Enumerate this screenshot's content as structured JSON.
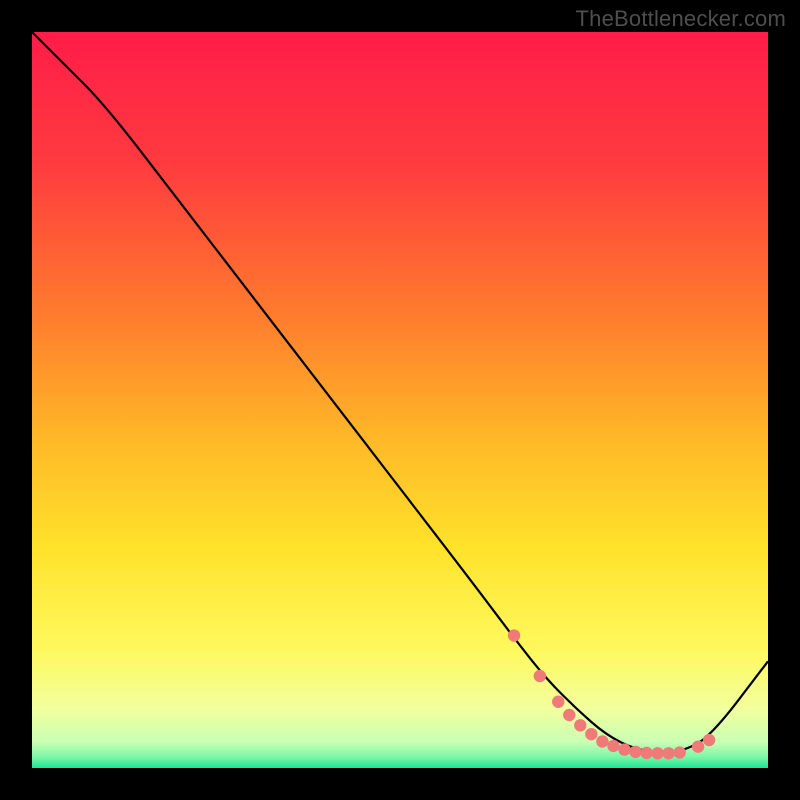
{
  "watermark": "TheBottlenecker.com",
  "chart_data": {
    "type": "line",
    "title": "",
    "xlabel": "",
    "ylabel": "",
    "xlim": [
      0,
      100
    ],
    "ylim": [
      0,
      100
    ],
    "grid": false,
    "series": [
      {
        "name": "curve",
        "x": [
          0,
          4,
          10,
          20,
          30,
          40,
          50,
          60,
          66,
          70,
          74,
          78,
          82,
          86,
          88,
          92,
          100
        ],
        "y": [
          100,
          96,
          90,
          77,
          64,
          51,
          38,
          25,
          17,
          12,
          8,
          4.5,
          2.5,
          2,
          2.2,
          4,
          14.5
        ]
      }
    ],
    "markers": {
      "name": "dots",
      "color": "#ef7a78",
      "x": [
        65.5,
        69,
        71.5,
        73,
        74.5,
        76,
        77.5,
        79,
        80.5,
        82,
        83.5,
        85,
        86.5,
        88,
        90.5,
        92
      ],
      "y": [
        18,
        12.5,
        9,
        7.2,
        5.8,
        4.6,
        3.6,
        3,
        2.5,
        2.2,
        2.05,
        2,
        2,
        2.1,
        2.9,
        3.8
      ]
    },
    "gradient_stops": [
      {
        "offset": 0.0,
        "color": "#ff1c49"
      },
      {
        "offset": 0.18,
        "color": "#ff3b3f"
      },
      {
        "offset": 0.38,
        "color": "#ff7a2e"
      },
      {
        "offset": 0.55,
        "color": "#ffb728"
      },
      {
        "offset": 0.7,
        "color": "#ffe22a"
      },
      {
        "offset": 0.84,
        "color": "#fff95e"
      },
      {
        "offset": 0.92,
        "color": "#f2ff9e"
      },
      {
        "offset": 0.965,
        "color": "#c9ffb4"
      },
      {
        "offset": 0.985,
        "color": "#7cf7a8"
      },
      {
        "offset": 1.0,
        "color": "#1de592"
      }
    ]
  }
}
